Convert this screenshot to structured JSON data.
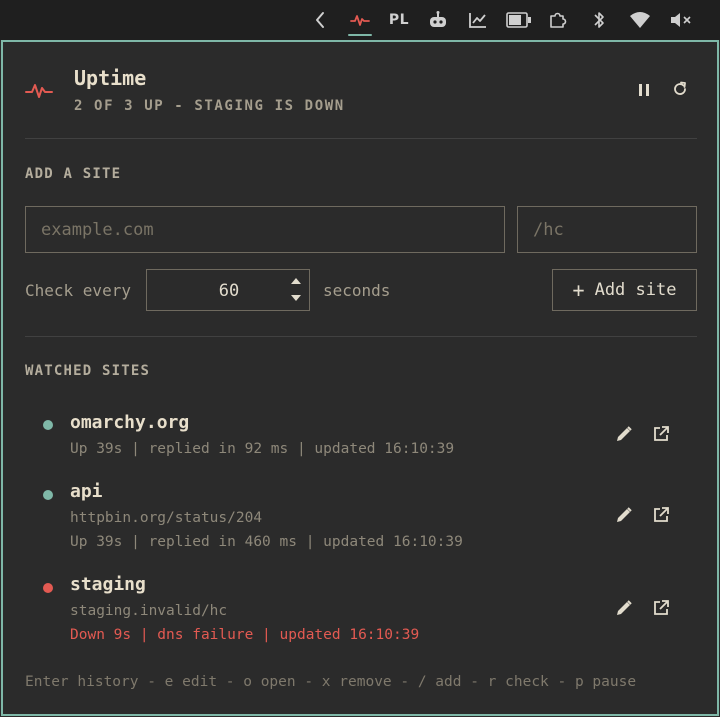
{
  "topbar": {
    "icons": [
      "chevron-left-icon",
      "pulse-icon",
      "robot-icon",
      "chart-icon",
      "battery-icon",
      "puzzle-icon",
      "bluetooth-icon",
      "wifi-icon",
      "volume-muted-icon"
    ],
    "language": "PL"
  },
  "header": {
    "title": "Uptime",
    "subtitle": "2 OF 3 UP - STAGING IS DOWN",
    "icon": "pulse-icon",
    "pause_icon": "pause-icon",
    "refresh_icon": "refresh-icon"
  },
  "add_site": {
    "label": "ADD A SITE",
    "url_placeholder": "example.com",
    "path_placeholder": "/hc",
    "check_every_label": "Check every",
    "interval_value": "60",
    "seconds_label": "seconds",
    "add_button_label": "Add site"
  },
  "watched": {
    "label": "WATCHED SITES",
    "sites": [
      {
        "name": "omarchy.org",
        "status": "up",
        "detail": "",
        "status_line": "Up 39s | replied in 92 ms | updated 16:10:39"
      },
      {
        "name": "api",
        "status": "up",
        "detail": "httpbin.org/status/204",
        "status_line": "Up 39s | replied in 460 ms | updated 16:10:39"
      },
      {
        "name": "staging",
        "status": "down",
        "detail": "staging.invalid/hc",
        "status_line": "Down 9s | dns failure | updated 16:10:39"
      }
    ]
  },
  "footer": {
    "hint": "Enter history - e edit - o open - x remove - / add - r check - p pause"
  },
  "colors": {
    "accent": "#7fb8a8",
    "up": "#7fb8a8",
    "down": "#e35a52",
    "text": "#e8dfcb",
    "muted": "#8e887a",
    "background": "#2b2b2b"
  }
}
